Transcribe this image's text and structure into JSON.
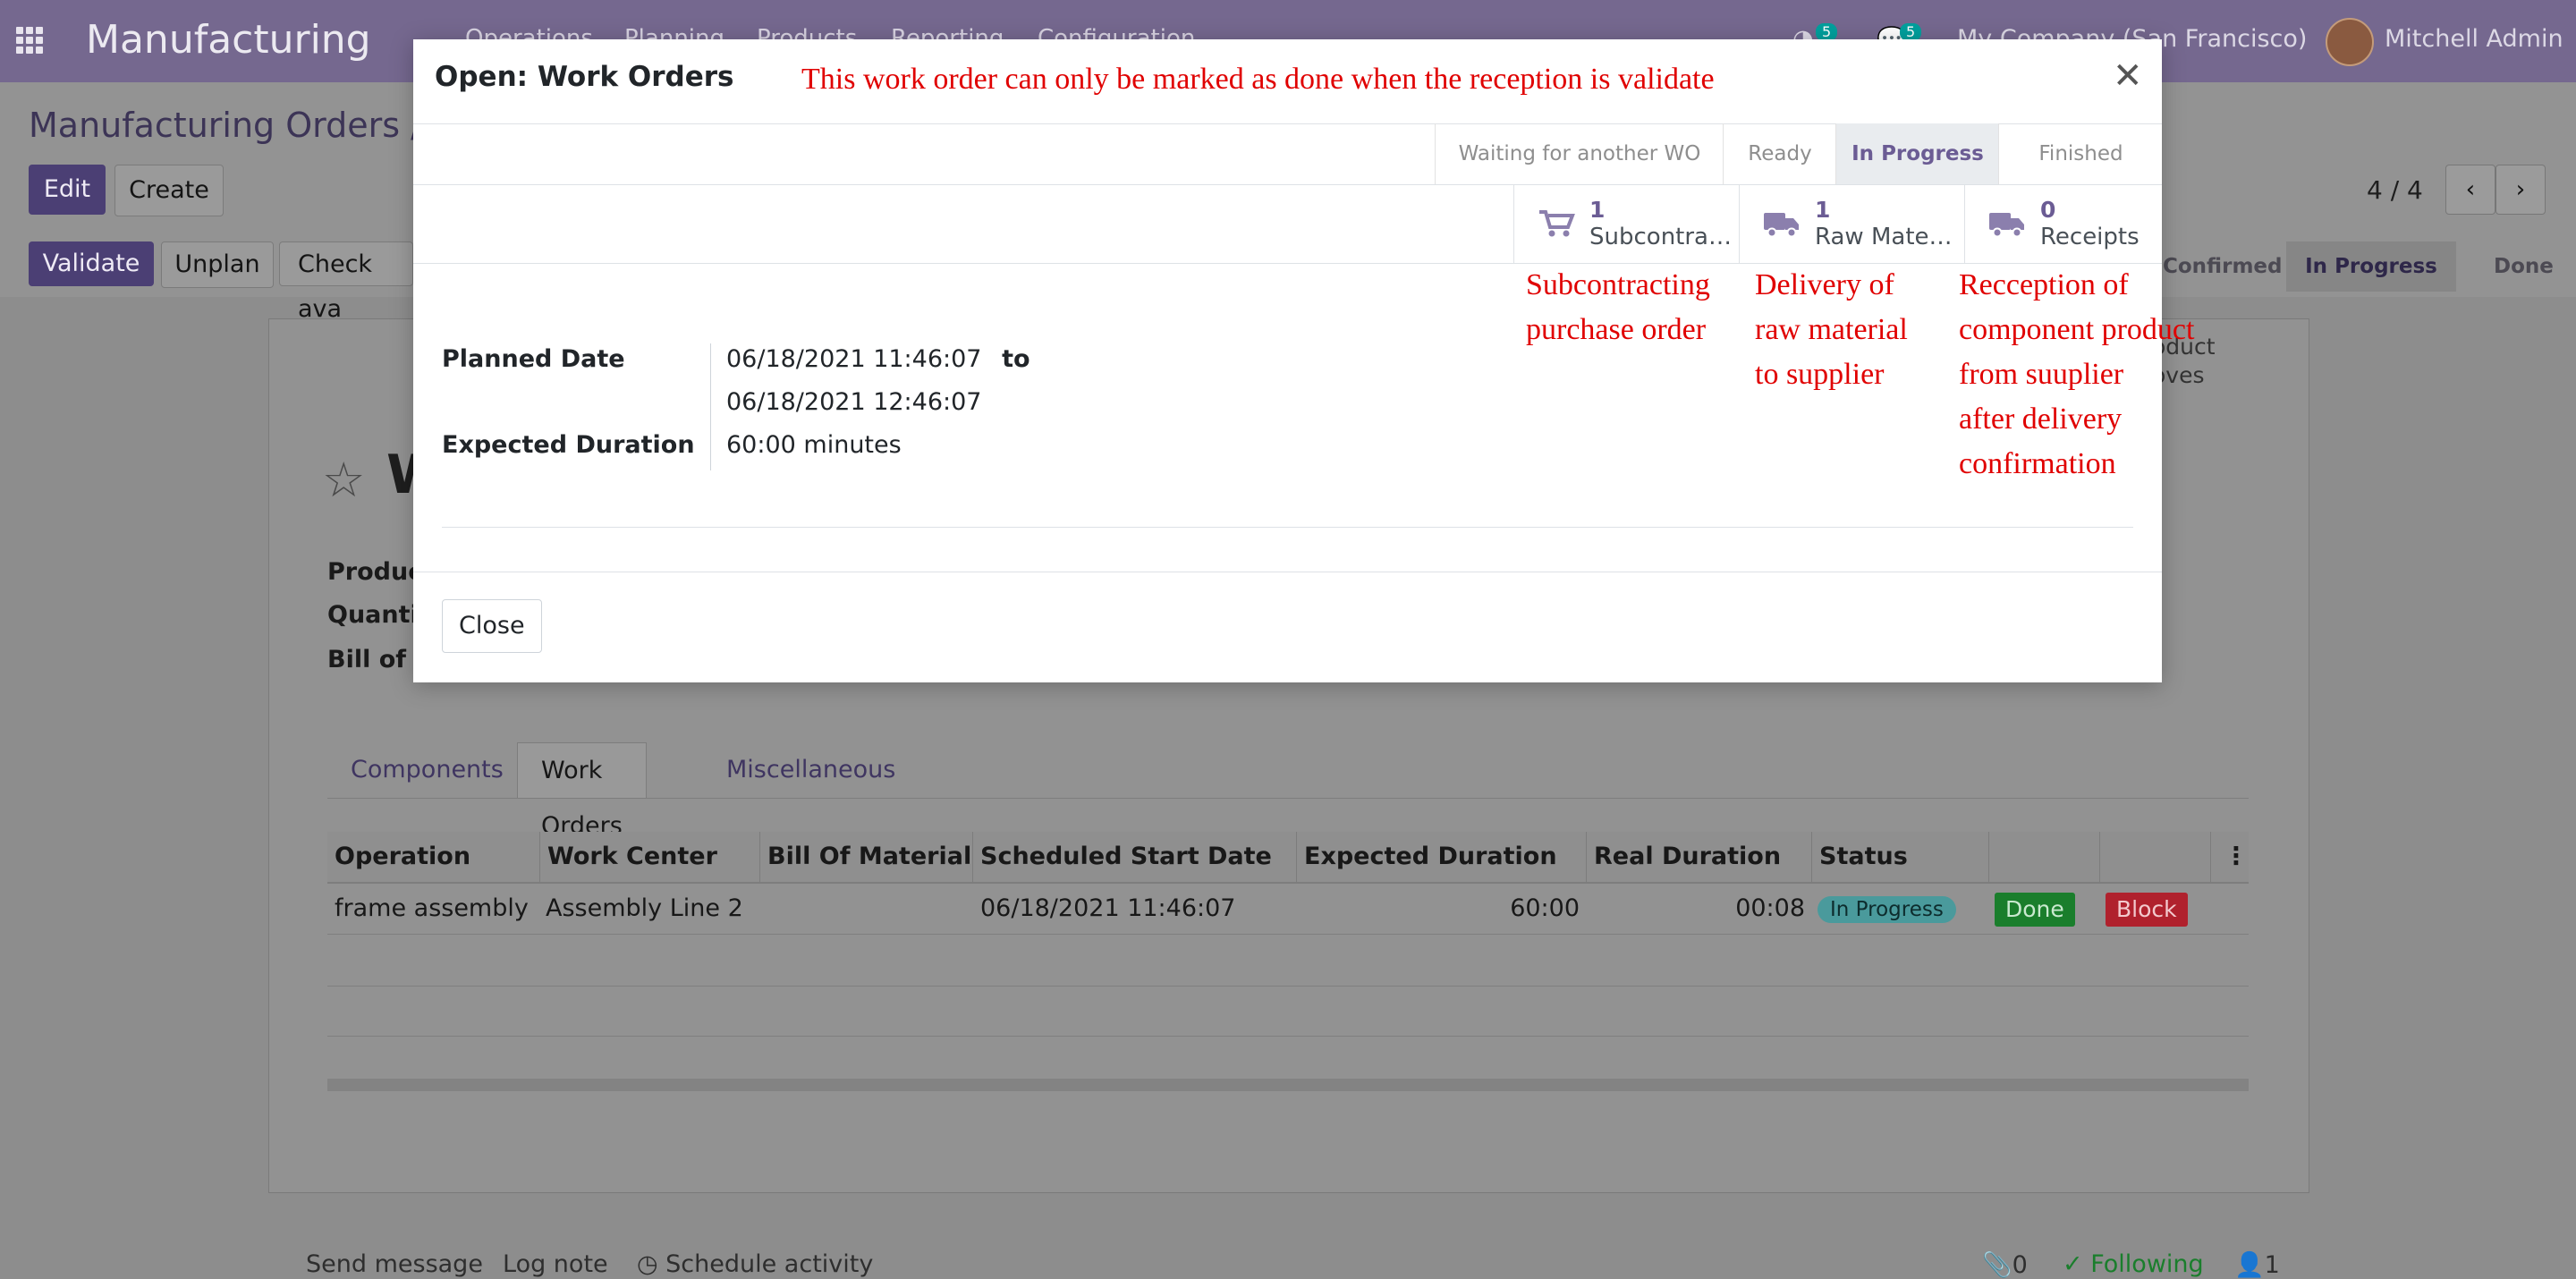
{
  "navbar": {
    "app_name": "Manufacturing",
    "menu": [
      "Operations",
      "Planning",
      "Products",
      "Reporting",
      "Configuration"
    ],
    "activity_count": "5",
    "messages_count": "5",
    "company": "My Company (San Francisco)",
    "user": "Mitchell Admin"
  },
  "control": {
    "breadcrumb_root": "Manufacturing Orders",
    "breadcrumb_sep": "/",
    "edit_label": "Edit",
    "create_label": "Create",
    "pager": "4 / 4",
    "validate_label": "Validate",
    "unplan_label": "Unplan",
    "check_label": "Check ava",
    "status_confirmed": "Confirmed",
    "status_in_progress": "In Progress",
    "status_done": "Done"
  },
  "sheet": {
    "title_fragment": "W",
    "product_label": "Produc",
    "quantity_label": "Quantit",
    "bom_label": "Bill of M",
    "smart_fragment_1": "oduct",
    "smart_fragment_2": "oves"
  },
  "tabs": [
    "Components",
    "Work Orders",
    "Miscellaneous"
  ],
  "work_orders": {
    "columns": [
      "Operation",
      "Work Center",
      "Bill Of Material",
      "Scheduled Start Date",
      "Expected Duration",
      "Real Duration",
      "Status"
    ],
    "rows": [
      {
        "operation": "frame assembly",
        "work_center": "Assembly Line 2",
        "bom": "",
        "start": "06/18/2021 11:46:07",
        "expected": "60:00",
        "real": "00:08",
        "status": "In Progress",
        "done_label": "Done",
        "block_label": "Block"
      }
    ]
  },
  "chatter": {
    "send_message": "Send message",
    "log_note": "Log note",
    "schedule": "Schedule activity",
    "attachments": "0",
    "following": "Following",
    "followers": "1"
  },
  "modal": {
    "title": "Open: Work Orders",
    "annotation_top": "This work order can only be marked as done when the reception is validate",
    "stages": [
      "Waiting for another WO",
      "Ready",
      "In Progress",
      "Finished"
    ],
    "active_stage": "In Progress",
    "smart_buttons": [
      {
        "count": "1",
        "label": "Subcontra…",
        "icon": "cart-icon"
      },
      {
        "count": "1",
        "label": "Raw Mate…",
        "icon": "truck-icon"
      },
      {
        "count": "0",
        "label": "Receipts",
        "icon": "truck-icon"
      }
    ],
    "annotations": [
      [
        "Subcontracting",
        "purchase order"
      ],
      [
        "Delivery of",
        "raw material",
        "to supplier"
      ],
      [
        "Recception of",
        "component product",
        "from suuplier",
        "after delivery",
        "confirmation"
      ]
    ],
    "planned_date_label": "Planned Date",
    "planned_from": "06/18/2021 11:46:07",
    "to_label": "to",
    "planned_to": "06/18/2021 12:46:07",
    "expected_duration_label": "Expected Duration",
    "expected_duration_value": "60:00",
    "expected_duration_unit": "minutes",
    "close_label": "Close"
  },
  "colors": {
    "navbar": "#75688f",
    "primary": "#4b3f74",
    "annotation_red": "#e00000",
    "status_pill": "#4a9a9c",
    "done_green": "#1a7e2c",
    "block_red": "#b0212d"
  }
}
